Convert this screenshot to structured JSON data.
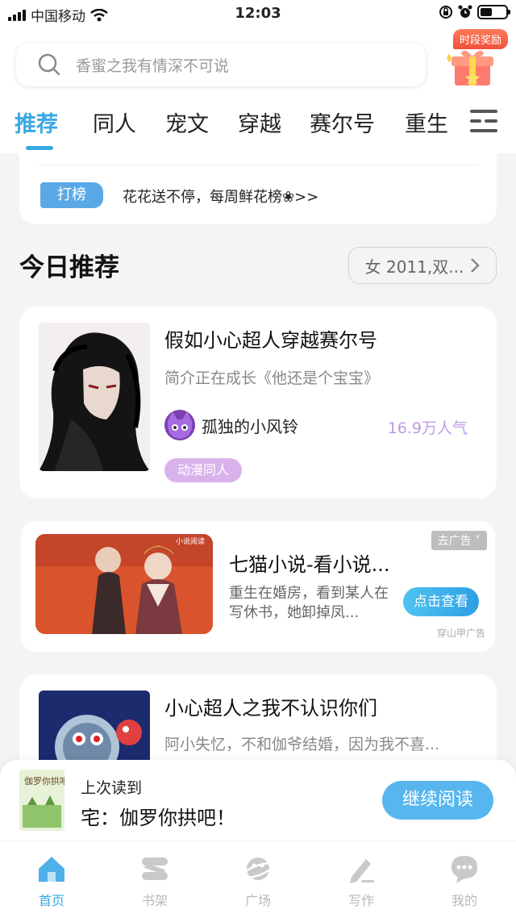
{
  "status_bar": {
    "carrier": "中国移动",
    "time": "12:03"
  },
  "search": {
    "placeholder": "香蜜之我有情深不可说"
  },
  "reward": {
    "badge": "时段奖励"
  },
  "tabs": [
    {
      "label": "推荐",
      "active": true
    },
    {
      "label": "同人"
    },
    {
      "label": "宠文"
    },
    {
      "label": "穿越"
    },
    {
      "label": "赛尔号"
    },
    {
      "label": "重生"
    }
  ],
  "notice": {
    "tag": "打榜",
    "text": "花花送不停，每周鲜花榜❀>>"
  },
  "section": {
    "title": "今日推荐",
    "filter": "女 2011,双..."
  },
  "books": [
    {
      "title": "假如小心超人穿越赛尔号",
      "intro": "简介正在成长《他还是个宝宝》",
      "author": "孤独的小风铃",
      "popularity": "16.9万人气",
      "genre": "动漫同人"
    },
    {
      "title": "小心超人之我不认识你们",
      "intro": "阿小失忆，不和伽爷结婚，因为我不喜..."
    }
  ],
  "ad": {
    "close_label": "去广告",
    "title": "七猫小说-看小说...",
    "desc": "重生在婚房，看到某人在写休书，她卸掉凤...",
    "button": "点击查看",
    "source": "穿山甲广告",
    "image_caption": "小说阅读"
  },
  "continue_reading": {
    "label": "上次读到",
    "book": "宅：伽罗你拱吧！",
    "button": "继续阅读",
    "cover_text": "伽罗你拱吧!"
  },
  "tabbar": [
    {
      "label": "首页",
      "icon": "home-icon",
      "active": true
    },
    {
      "label": "书架",
      "icon": "bookshelf-icon"
    },
    {
      "label": "广场",
      "icon": "planet-icon"
    },
    {
      "label": "写作",
      "icon": "pen-icon"
    },
    {
      "label": "我的",
      "icon": "chat-icon"
    }
  ],
  "colors": {
    "accent": "#3aa8e6",
    "genre_tag": "#d9b2ec",
    "popularity": "#c09ae8"
  }
}
